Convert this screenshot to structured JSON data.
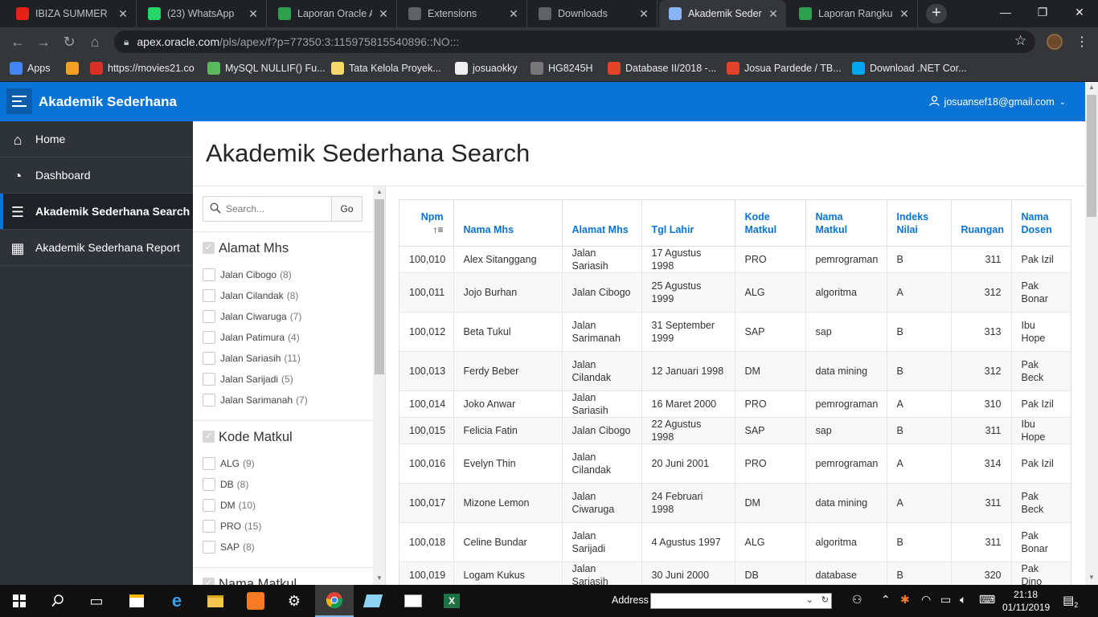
{
  "browser": {
    "tabs": [
      {
        "title": "IBIZA SUMMER",
        "color": "#e62117",
        "icon": "youtube-icon",
        "active": false
      },
      {
        "title": "(23) WhatsApp",
        "color": "#25d366",
        "icon": "whatsapp-icon",
        "active": false
      },
      {
        "title": "Laporan Oracle AP",
        "color": "#2e9e4f",
        "icon": "leaf-icon",
        "active": false
      },
      {
        "title": "Extensions",
        "color": "#5f6368",
        "icon": "puzzle-icon",
        "active": false
      },
      {
        "title": "Downloads",
        "color": "#5f6368",
        "icon": "download-icon",
        "active": false
      },
      {
        "title": "Akademik Sederha",
        "color": "#8ab4f8",
        "icon": "apex-icon",
        "active": true
      },
      {
        "title": "Laporan Rangkum",
        "color": "#2e9e4f",
        "icon": "leaf-icon",
        "active": false
      }
    ],
    "url_host": "apex.oracle.com",
    "url_path": "/pls/apex/f?p=77350:3:115975815540896::NO:::",
    "bookmarks": [
      {
        "label": "Apps",
        "color": "#4285f4"
      },
      {
        "label": "",
        "color": "#f4a020"
      },
      {
        "label": "https://movies21.co",
        "color": "#d93025"
      },
      {
        "label": "MySQL NULLIF() Fu...",
        "color": "#5cb85c"
      },
      {
        "label": "Tata Kelola Proyek...",
        "color": "#f6d86b"
      },
      {
        "label": "josuaokky",
        "color": "#f0f0f0"
      },
      {
        "label": "HG8245H",
        "color": "#777777"
      },
      {
        "label": "Database II/2018 -...",
        "color": "#e24329"
      },
      {
        "label": "Josua Pardede / TB...",
        "color": "#e24329"
      },
      {
        "label": "Download .NET Cor...",
        "color": "#00a4ef"
      }
    ]
  },
  "apex": {
    "app_title": "Akademik Sederhana",
    "user": "josuansef18@gmail.com",
    "nav": [
      {
        "label": "Home",
        "icon": "home-icon",
        "glyph": "⌂",
        "current": false
      },
      {
        "label": "Dashboard",
        "icon": "dashboard-icon",
        "glyph": "◔",
        "current": false
      },
      {
        "label": "Akademik Sederhana Search",
        "icon": "search-list-icon",
        "glyph": "☰",
        "current": true
      },
      {
        "label": "Akademik Sederhana Report",
        "icon": "table-icon",
        "glyph": "▦",
        "current": false
      }
    ],
    "page_title": "Akademik Sederhana Search",
    "search": {
      "placeholder": "Search...",
      "go_label": "Go"
    },
    "facets": [
      {
        "title": "Alamat Mhs",
        "items": [
          {
            "label": "Jalan Cibogo",
            "count": "(8)"
          },
          {
            "label": "Jalan Cilandak",
            "count": "(8)"
          },
          {
            "label": "Jalan Ciwaruga",
            "count": "(7)"
          },
          {
            "label": "Jalan Patimura",
            "count": "(4)"
          },
          {
            "label": "Jalan Sariasih",
            "count": "(11)"
          },
          {
            "label": "Jalan Sarijadi",
            "count": "(5)"
          },
          {
            "label": "Jalan Sarimanah",
            "count": "(7)"
          }
        ]
      },
      {
        "title": "Kode Matkul",
        "items": [
          {
            "label": "ALG",
            "count": "(9)"
          },
          {
            "label": "DB",
            "count": "(8)"
          },
          {
            "label": "DM",
            "count": "(10)"
          },
          {
            "label": "PRO",
            "count": "(15)"
          },
          {
            "label": "SAP",
            "count": "(8)"
          }
        ]
      },
      {
        "title": "Nama Matkul",
        "items": []
      }
    ],
    "table": {
      "columns": [
        {
          "label": "Npm",
          "lines": [
            "Npm"
          ],
          "num": true,
          "sorted": true
        },
        {
          "label": "Nama Mhs",
          "lines": [
            "Nama Mhs"
          ],
          "num": false
        },
        {
          "label": "Alamat Mhs",
          "lines": [
            "Alamat Mhs"
          ],
          "num": false
        },
        {
          "label": "Tgl Lahir",
          "lines": [
            "Tgl Lahir"
          ],
          "num": false
        },
        {
          "label": "Kode Matkul",
          "lines": [
            "Kode",
            "Matkul"
          ],
          "num": false
        },
        {
          "label": "Nama Matkul",
          "lines": [
            "Nama",
            "Matkul"
          ],
          "num": false
        },
        {
          "label": "Indeks Nilai",
          "lines": [
            "Indeks",
            "Nilai"
          ],
          "num": false
        },
        {
          "label": "Ruangan",
          "lines": [
            "Ruangan"
          ],
          "num": true
        },
        {
          "label": "Nama Dosen",
          "lines": [
            "Nama",
            "Dosen"
          ],
          "num": false
        }
      ],
      "rows": [
        [
          "100,010",
          "Alex Sitanggang",
          "Jalan Sariasih",
          "17 Agustus 1998",
          "PRO",
          "pemrograman",
          "B",
          "311",
          "Pak Izil"
        ],
        [
          "100,011",
          "Jojo Burhan",
          "Jalan Cibogo",
          "25 Agustus 1999",
          "ALG",
          "algoritma",
          "A",
          "312",
          "Pak Bonar"
        ],
        [
          "100,012",
          "Beta Tukul",
          "Jalan Sarimanah",
          "31 September 1999",
          "SAP",
          "sap",
          "B",
          "313",
          "Ibu Hope"
        ],
        [
          "100,013",
          "Ferdy Beber",
          "Jalan Cilandak",
          "12 Januari 1998",
          "DM",
          "data mining",
          "B",
          "312",
          "Pak Beck"
        ],
        [
          "100,014",
          "Joko Anwar",
          "Jalan Sariasih",
          "16 Maret 2000",
          "PRO",
          "pemrograman",
          "A",
          "310",
          "Pak Izil"
        ],
        [
          "100,015",
          "Felicia Fatin",
          "Jalan Cibogo",
          "22 Agustus 1998",
          "SAP",
          "sap",
          "B",
          "311",
          "Ibu Hope"
        ],
        [
          "100,016",
          "Evelyn Thin",
          "Jalan Cilandak",
          "20 Juni 2001",
          "PRO",
          "pemrograman",
          "A",
          "314",
          "Pak Izil"
        ],
        [
          "100,017",
          "Mizone Lemon",
          "Jalan Ciwaruga",
          "24 Februari 1998",
          "DM",
          "data mining",
          "A",
          "311",
          "Pak Beck"
        ],
        [
          "100,018",
          "Celine Bundar",
          "Jalan Sarijadi",
          "4 Agustus 1997",
          "ALG",
          "algoritma",
          "B",
          "311",
          "Pak Bonar"
        ],
        [
          "100,019",
          "Logam Kukus",
          "Jalan Sariasih",
          "30 Juni 2000",
          "DB",
          "database",
          "B",
          "320",
          "Pak Dino"
        ]
      ]
    }
  },
  "taskbar": {
    "address_label": "Address",
    "time": "21:18",
    "date": "01/11/2019",
    "notification_count": "2"
  }
}
